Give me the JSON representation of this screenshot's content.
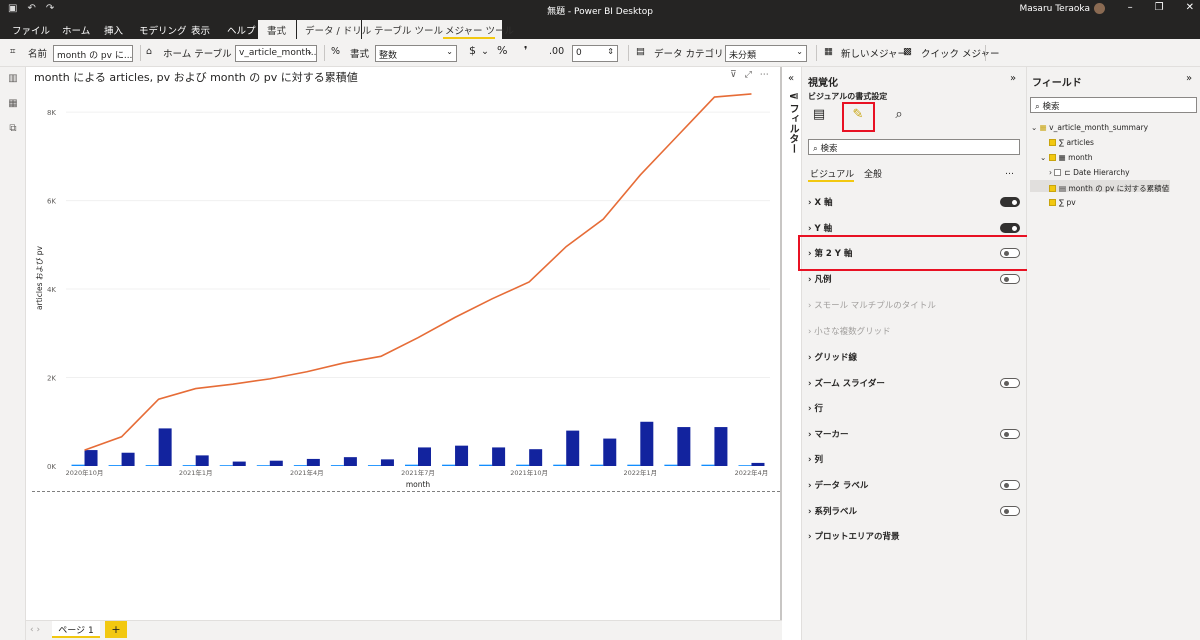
{
  "window": {
    "title": "無題 - Power BI Desktop",
    "user": "Masaru Teraoka"
  },
  "menu": {
    "items": [
      "ファイル",
      "ホーム",
      "挿入",
      "モデリング",
      "表示",
      "ヘルプ",
      "書式",
      "データ / ドリル",
      "テーブル ツール",
      "メジャー ツール"
    ]
  },
  "ribbon": {
    "name_label": "名前",
    "name_value": "month の pv に...",
    "home_table_label": "ホーム テーブル",
    "home_table_value": "v_article_month...",
    "format_label": "書式",
    "format_value": "整数",
    "currency_symbol": "$",
    "percent_symbol": "%",
    "comma_symbol": "❜",
    "decimal_value": "0",
    "data_category_label": "データ カテゴリ",
    "data_category_value": "未分類",
    "new_measure_label": "新しいメジャー",
    "quick_measure_label": "クイック メジャー"
  },
  "visual": {
    "title": "month による articles, pv および month の pv に対する累積値"
  },
  "chart_data": {
    "type": "bar",
    "title": "month による articles, pv および month の pv に対する累積値",
    "xlabel": "month",
    "ylabel": "articles および pv",
    "ylim": [
      0,
      8500
    ],
    "yticks": [
      "0K",
      "2K",
      "4K",
      "6K",
      "8K"
    ],
    "ytick_values": [
      0,
      2000,
      4000,
      6000,
      8000
    ],
    "x_tick_labels": [
      "2020年10月",
      "2021年1月",
      "2021年4月",
      "2021年7月",
      "2021年10月",
      "2022年1月",
      "2022年4月"
    ],
    "x_tick_index": [
      0,
      3,
      6,
      9,
      12,
      15,
      18
    ],
    "categories": [
      "2020-10",
      "2020-11",
      "2020-12",
      "2021-01",
      "2021-02",
      "2021-03",
      "2021-04",
      "2021-05",
      "2021-06",
      "2021-07",
      "2021-08",
      "2021-09",
      "2021-10",
      "2021-11",
      "2021-12",
      "2022-01",
      "2022-02",
      "2022-03",
      "2022-04"
    ],
    "series": [
      {
        "name": "articles",
        "kind": "bar",
        "color": "#118dff",
        "values": [
          30,
          20,
          20,
          20,
          10,
          10,
          20,
          20,
          20,
          30,
          30,
          30,
          30,
          30,
          30,
          30,
          30,
          30,
          0
        ]
      },
      {
        "name": "pv",
        "kind": "bar",
        "color": "#12239e",
        "values": [
          360,
          300,
          850,
          240,
          100,
          120,
          160,
          200,
          150,
          420,
          460,
          420,
          380,
          800,
          620,
          1000,
          880,
          880,
          70
        ]
      },
      {
        "name": "month の pv に対する累積値",
        "kind": "line",
        "color": "#e66c37",
        "values": [
          360,
          660,
          1510,
          1750,
          1850,
          1970,
          2130,
          2330,
          2480,
          2900,
          3360,
          3780,
          4160,
          4960,
          5580,
          6580,
          7460,
          8340,
          8410
        ]
      }
    ],
    "grid": true
  },
  "pages": {
    "tabs": [
      "ページ 1"
    ],
    "add_label": "+"
  },
  "filters": {
    "label": "フィルター"
  },
  "viz_pane": {
    "title": "視覚化",
    "subtitle": "ビジュアルの書式設定",
    "search_placeholder": "検索",
    "tabs": [
      "ビジュアル",
      "全般"
    ],
    "more": "…",
    "sections": [
      {
        "label": "X 軸",
        "toggle": "on"
      },
      {
        "label": "Y 軸",
        "toggle": "on"
      },
      {
        "label": "第 2 Y 軸",
        "toggle": "off"
      },
      {
        "label": "凡例",
        "toggle": "off"
      },
      {
        "label": "スモール マルチプルのタイトル",
        "toggle": "none",
        "disabled": true
      },
      {
        "label": "小さな複数グリッド",
        "toggle": "none",
        "disabled": true
      },
      {
        "label": "グリッド線",
        "toggle": "none"
      },
      {
        "label": "ズーム スライダー",
        "toggle": "off"
      },
      {
        "label": "行",
        "toggle": "none"
      },
      {
        "label": "マーカー",
        "toggle": "off"
      },
      {
        "label": "列",
        "toggle": "none"
      },
      {
        "label": "データ ラベル",
        "toggle": "off"
      },
      {
        "label": "系列ラベル",
        "toggle": "off"
      },
      {
        "label": "プロットエリアの背景",
        "toggle": "none"
      }
    ]
  },
  "fields_pane": {
    "title": "フィールド",
    "search_placeholder": "検索",
    "table": "v_article_month_summary",
    "fields": {
      "articles": "articles",
      "month": "month",
      "date_hierarchy": "Date Hierarchy",
      "cumulative": "month の pv に対する累積値",
      "pv": "pv"
    }
  }
}
